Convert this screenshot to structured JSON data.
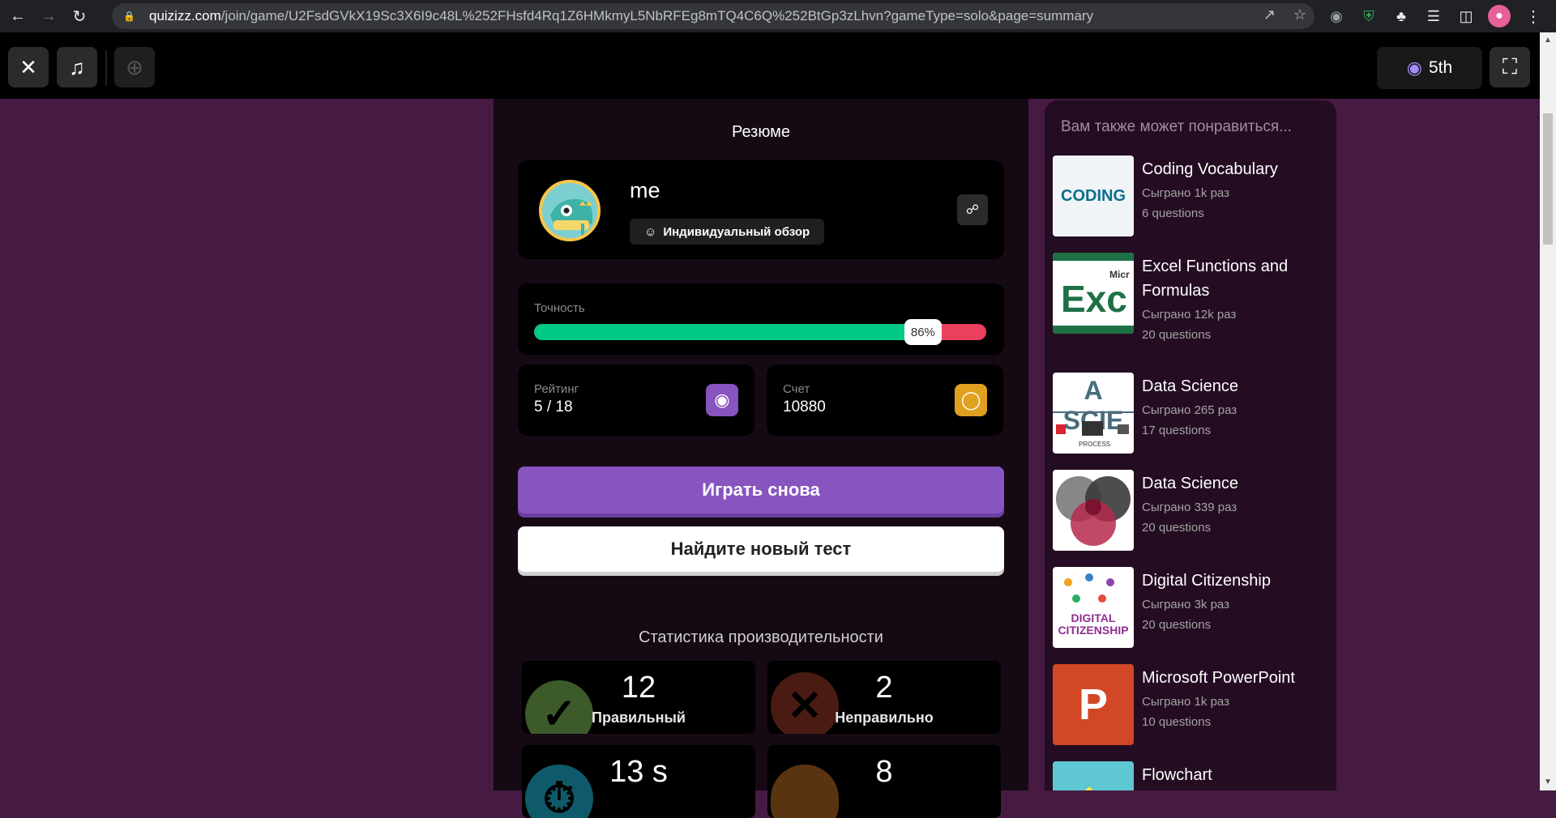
{
  "browser": {
    "url_host": "quizizz.com",
    "url_path": "/join/game/U2FsdGVkX19Sc3X6I9c48L%252FHsfd4Rq1Z6HMkmyL5NbRFEg8mTQ4C6Q%252BtGp3zLhvn?gameType=solo&page=summary"
  },
  "topbar": {
    "rank_label": "5th"
  },
  "summary": {
    "title": "Резюме",
    "player_name": "me",
    "review_label": "Индивидуальный обзор",
    "accuracy_label": "Точность",
    "accuracy_value": "86%",
    "accuracy_fraction": 0.86,
    "rank_label": "Рейтинг",
    "rank_value": "5 / 18",
    "score_label": "Счет",
    "score_value": "10880",
    "play_again": "Играть снова",
    "find_test": "Найдите новый тест",
    "performance_title": "Статистика производительности",
    "performance": {
      "correct_value": "12",
      "correct_label": "Правильный",
      "wrong_value": "2",
      "wrong_label": "Неправильно",
      "time_value": "13 s",
      "streak_value": "8"
    }
  },
  "recommendations": {
    "title": "Вам также может понравиться...",
    "items": [
      {
        "title": "Coding Vocabulary",
        "plays": "Сыграно 1k раз",
        "questions": "6 questions"
      },
      {
        "title": "Excel Functions and Formulas",
        "plays": "Сыграно 12k раз",
        "questions": "20 questions"
      },
      {
        "title": "Data Science",
        "plays": "Сыграно 265 раз",
        "questions": "17 questions"
      },
      {
        "title": "Data Science",
        "plays": "Сыграно 339 раз",
        "questions": "20 questions"
      },
      {
        "title": "Digital Citizenship",
        "plays": "Сыграно 3k раз",
        "questions": "20 questions"
      },
      {
        "title": "Microsoft PowerPoint",
        "plays": "Сыграно 1k раз",
        "questions": "10 questions"
      },
      {
        "title": "Flowchart",
        "plays": "",
        "questions": ""
      }
    ]
  },
  "thumbnails": {
    "coding": "CODING",
    "excel": "Exc",
    "excel_small": "Micr",
    "data_science": "A SCIE",
    "data_science_caption": "PROCESS",
    "digital": "DIGITAL CITIZENSHIP",
    "powerpoint": "P"
  },
  "colors": {
    "accent_purple": "#8854c0",
    "correct_green": "#00c985",
    "wrong_red": "#ec3f5e",
    "gold": "#e0a020",
    "background": "#461a42"
  }
}
